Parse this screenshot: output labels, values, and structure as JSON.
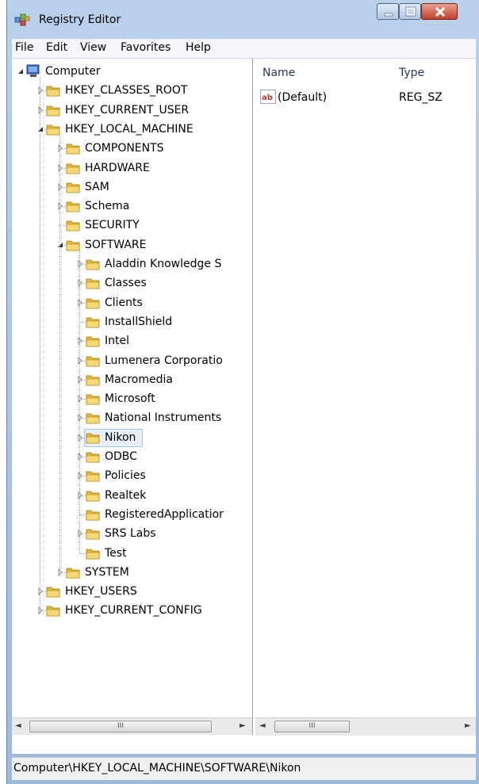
{
  "window": {
    "title": "Registry Editor"
  },
  "menu": [
    "File",
    "Edit",
    "View",
    "Favorites",
    "Help"
  ],
  "tree": [
    {
      "label": "Computer",
      "level": 0,
      "expander": "expanded",
      "icon": "computer-icon"
    },
    {
      "label": "HKEY_CLASSES_ROOT",
      "level": 1,
      "expander": "collapsed",
      "icon": "folder-icon"
    },
    {
      "label": "HKEY_CURRENT_USER",
      "level": 1,
      "expander": "collapsed",
      "icon": "folder-icon"
    },
    {
      "label": "HKEY_LOCAL_MACHINE",
      "level": 1,
      "expander": "expanded",
      "icon": "folder-icon"
    },
    {
      "label": "COMPONENTS",
      "level": 2,
      "expander": "collapsed",
      "icon": "folder-icon"
    },
    {
      "label": "HARDWARE",
      "level": 2,
      "expander": "collapsed",
      "icon": "folder-icon"
    },
    {
      "label": "SAM",
      "level": 2,
      "expander": "collapsed",
      "icon": "folder-icon"
    },
    {
      "label": "Schema",
      "level": 2,
      "expander": "collapsed",
      "icon": "folder-icon"
    },
    {
      "label": "SECURITY",
      "level": 2,
      "expander": "none",
      "icon": "folder-icon"
    },
    {
      "label": "SOFTWARE",
      "level": 2,
      "expander": "expanded",
      "icon": "folder-icon"
    },
    {
      "label": "Aladdin Knowledge S",
      "level": 3,
      "expander": "collapsed",
      "icon": "folder-icon"
    },
    {
      "label": "Classes",
      "level": 3,
      "expander": "collapsed",
      "icon": "folder-icon"
    },
    {
      "label": "Clients",
      "level": 3,
      "expander": "collapsed",
      "icon": "folder-icon"
    },
    {
      "label": "InstallShield",
      "level": 3,
      "expander": "none",
      "icon": "folder-icon"
    },
    {
      "label": "Intel",
      "level": 3,
      "expander": "collapsed",
      "icon": "folder-icon"
    },
    {
      "label": "Lumenera Corporatio",
      "level": 3,
      "expander": "collapsed",
      "icon": "folder-icon"
    },
    {
      "label": "Macromedia",
      "level": 3,
      "expander": "collapsed",
      "icon": "folder-icon"
    },
    {
      "label": "Microsoft",
      "level": 3,
      "expander": "collapsed",
      "icon": "folder-icon"
    },
    {
      "label": "National Instruments",
      "level": 3,
      "expander": "collapsed",
      "icon": "folder-icon"
    },
    {
      "label": "Nikon",
      "level": 3,
      "expander": "collapsed",
      "icon": "folder-icon",
      "selected": true
    },
    {
      "label": "ODBC",
      "level": 3,
      "expander": "collapsed",
      "icon": "folder-icon"
    },
    {
      "label": "Policies",
      "level": 3,
      "expander": "collapsed",
      "icon": "folder-icon"
    },
    {
      "label": "Realtek",
      "level": 3,
      "expander": "collapsed",
      "icon": "folder-icon"
    },
    {
      "label": "RegisteredApplicatior",
      "level": 3,
      "expander": "none",
      "icon": "folder-icon"
    },
    {
      "label": "SRS Labs",
      "level": 3,
      "expander": "collapsed",
      "icon": "folder-icon"
    },
    {
      "label": "Test",
      "level": 3,
      "expander": "none",
      "icon": "folder-icon"
    },
    {
      "label": "SYSTEM",
      "level": 2,
      "expander": "collapsed",
      "icon": "folder-icon"
    },
    {
      "label": "HKEY_USERS",
      "level": 1,
      "expander": "collapsed",
      "icon": "folder-icon"
    },
    {
      "label": "HKEY_CURRENT_CONFIG",
      "level": 1,
      "expander": "collapsed",
      "icon": "folder-icon"
    }
  ],
  "list": {
    "columns": [
      "Name",
      "Type"
    ],
    "rows": [
      {
        "name": "(Default)",
        "type": "REG_SZ",
        "icon": "string-value-icon"
      }
    ]
  },
  "scrollbar": {
    "thumb_grip": "III"
  },
  "status": {
    "path": "Computer\\HKEY_LOCAL_MACHINE\\SOFTWARE\\Nikon"
  },
  "colors": {
    "folder": "#e8b830",
    "selection": "#e5f0fb",
    "title_bg": "#b9d1ea",
    "close": "#c4412a"
  }
}
